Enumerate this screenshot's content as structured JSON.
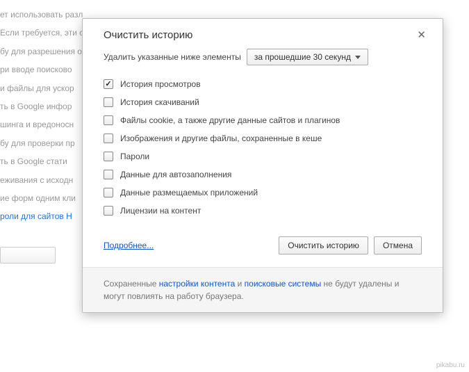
{
  "background": {
    "lines": [
      "ет использовать различные веб-службы, которые делают работу в Интернете",
      "Если требуется, эти службы можно отключить. Подробнее",
      "бу для разрешения о",
      "ри вводе поисково",
      "и файлы для ускор",
      "ть в Google инфор",
      "шинга и вредоносн",
      "бу для проверки пр",
      "ть в Google стати",
      "еживания с исходн",
      "",
      "ие форм одним кли",
      "роли для сайтов Н"
    ]
  },
  "dialog": {
    "title": "Очистить историю",
    "timeLabel": "Удалить указанные ниже элементы",
    "timeSelected": "за прошедшие 30 секунд",
    "items": [
      {
        "label": "История просмотров",
        "checked": true
      },
      {
        "label": "История скачиваний",
        "checked": false
      },
      {
        "label": "Файлы cookie, а также другие данные сайтов и плагинов",
        "checked": false
      },
      {
        "label": "Изображения и другие файлы, сохраненные в кеше",
        "checked": false
      },
      {
        "label": "Пароли",
        "checked": false
      },
      {
        "label": "Данные для автозаполнения",
        "checked": false
      },
      {
        "label": "Данные размещаемых приложений",
        "checked": false
      },
      {
        "label": "Лицензии на контент",
        "checked": false
      }
    ],
    "moreLink": "Подробнее...",
    "clearButton": "Очистить историю",
    "cancelButton": "Отмена",
    "footer": {
      "pre": "Сохраненные ",
      "link1": "настройки контента",
      "mid": " и ",
      "link2": "поисковые системы",
      "post": " не будут удалены и могут повлиять на работу браузера."
    }
  },
  "watermark": "pikabu.ru"
}
